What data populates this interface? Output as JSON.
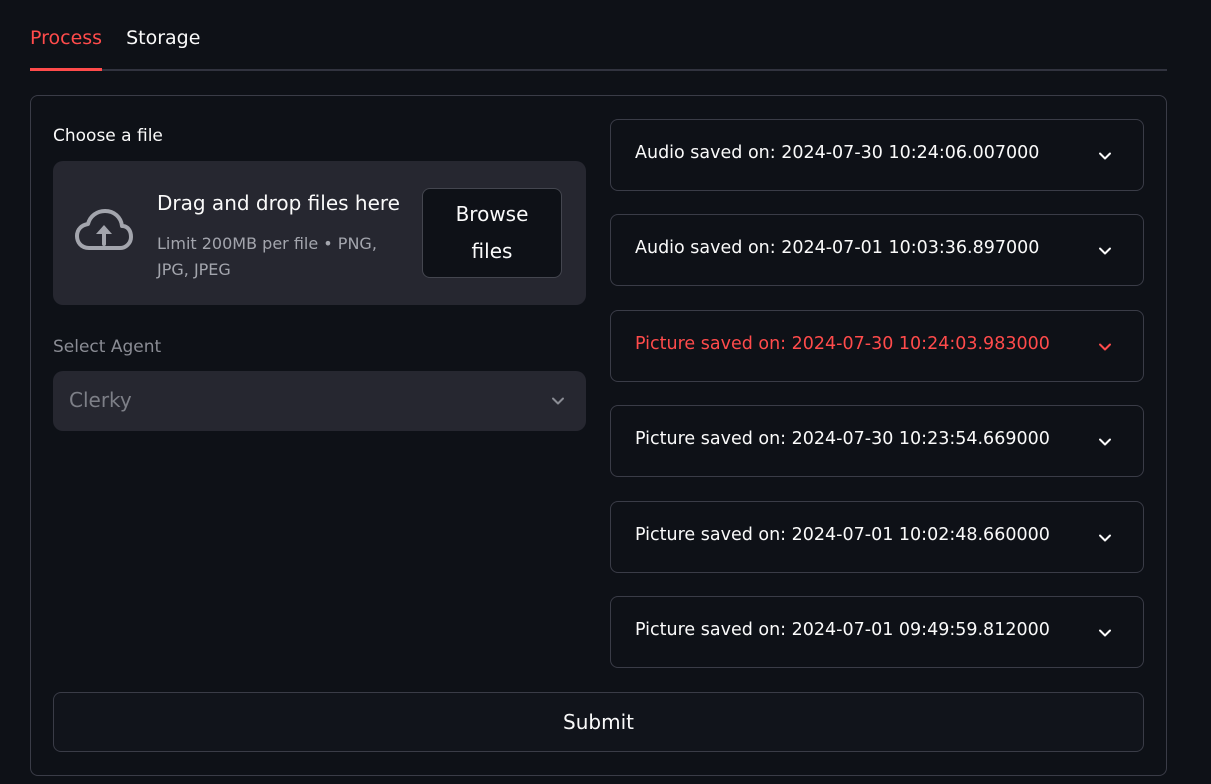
{
  "tabs": [
    {
      "label": "Process",
      "active": true
    },
    {
      "label": "Storage",
      "active": false
    }
  ],
  "uploader": {
    "label": "Choose a file",
    "drop_title": "Drag and drop files here",
    "drop_limit": "Limit 200MB per file • PNG, JPG, JPEG",
    "browse_label": "Browse files",
    "icon": "cloud-upload-icon"
  },
  "agent_select": {
    "label": "Select Agent",
    "value": "Clerky",
    "icon": "chevron-down-icon"
  },
  "saved_items": [
    {
      "label": "Audio saved on: 2024-07-30 10:24:06.007000"
    },
    {
      "label": "Audio saved on: 2024-07-01 10:03:36.897000"
    },
    {
      "label": "Picture saved on: 2024-07-30 10:24:03.983000"
    },
    {
      "label": "Picture saved on: 2024-07-30 10:23:54.669000"
    },
    {
      "label": "Picture saved on: 2024-07-01 10:02:48.660000"
    },
    {
      "label": "Picture saved on: 2024-07-01 09:49:59.812000"
    }
  ],
  "submit_label": "Submit",
  "colors": {
    "background": "#0e1117",
    "accent": "#ff4b4b",
    "surface": "#262730",
    "text": "#fafafa"
  }
}
